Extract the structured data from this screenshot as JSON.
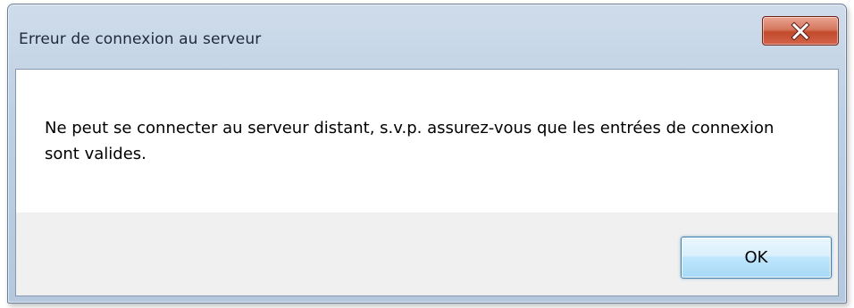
{
  "dialog": {
    "title": "Erreur de connexion au serveur",
    "close_icon": "close-x-icon",
    "message": "Ne peut se connecter au serveur distant, s.v.p. assurez-vous que les entrées de connexion sont valides.",
    "ok_label": "OK"
  },
  "colors": {
    "title_bar": "#bccfe3",
    "close_button": "#c24a2c",
    "ok_button_border": "#3c7fb1",
    "footer_background": "#f0f0f0"
  }
}
